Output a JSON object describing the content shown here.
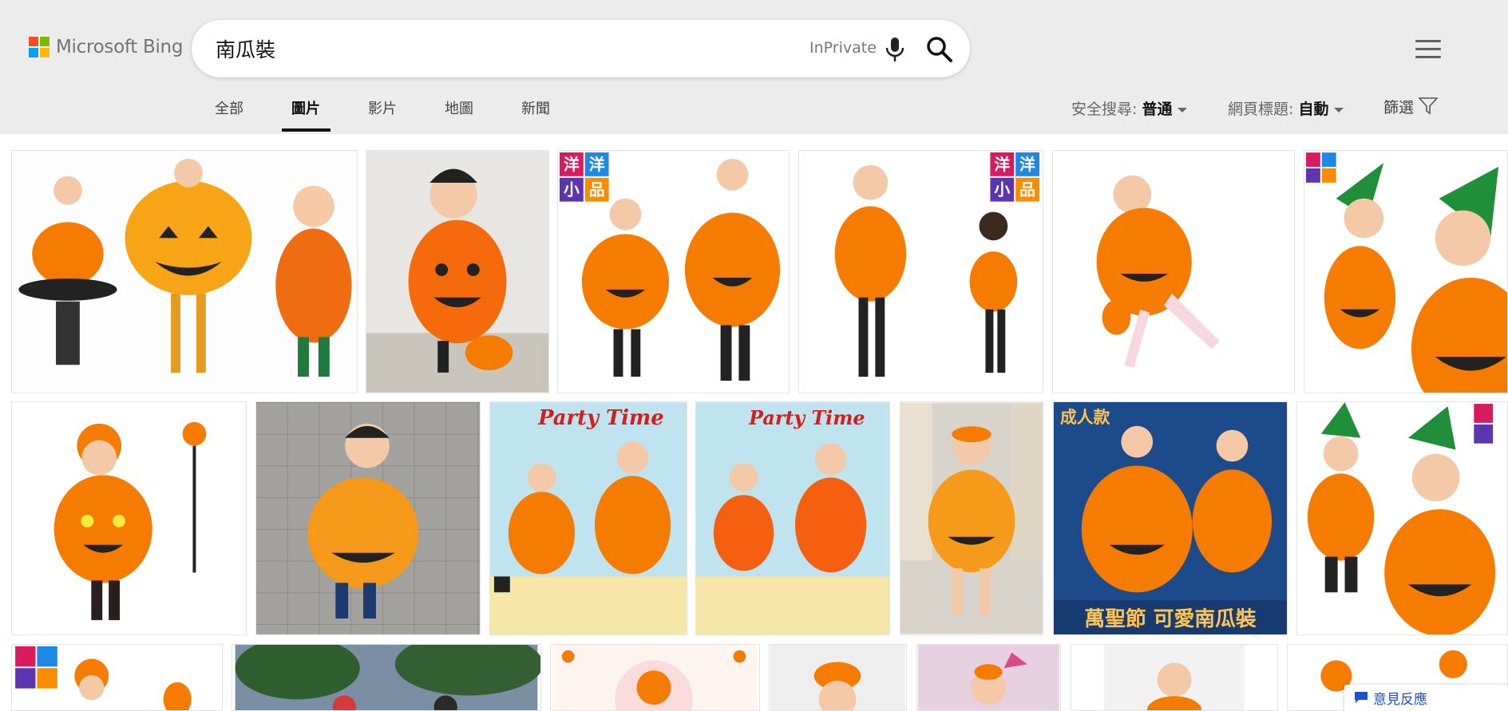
{
  "app": {
    "logo_text": "Microsoft Bing",
    "logo_colors": [
      "#f25022",
      "#7fba00",
      "#00a4ef",
      "#ffb900"
    ]
  },
  "search": {
    "query": "南瓜裝",
    "inprivate": "InPrivate",
    "mic_icon": "microphone-icon",
    "search_icon": "search-icon"
  },
  "tabs": [
    {
      "label": "全部"
    },
    {
      "label": "圖片"
    },
    {
      "label": "影片"
    },
    {
      "label": "地圖"
    },
    {
      "label": "新聞"
    }
  ],
  "active_tab": "圖片",
  "filters": {
    "safe_search_label": "安全搜尋:",
    "safe_search_value": "普通",
    "page_title_label": "網頁標題:",
    "page_title_value": "自動",
    "filter_label": "篩選"
  },
  "feedback": {
    "label": "意見反應"
  },
  "overlay_text": {
    "tile_brand_top": "洋",
    "tile_brand_top2": "洋",
    "tile_brand_bottom": "小",
    "tile_brand_bottom2": "品",
    "party_time": "Party Time",
    "adult_label": "成人款",
    "halloween_caption": "萬聖節 可愛南瓜裝"
  },
  "colors": {
    "header_bg": "#ececec",
    "pumpkin": "#f57c00",
    "leaf": "#2e9e3e",
    "link_blue": "#1a4fd6"
  }
}
